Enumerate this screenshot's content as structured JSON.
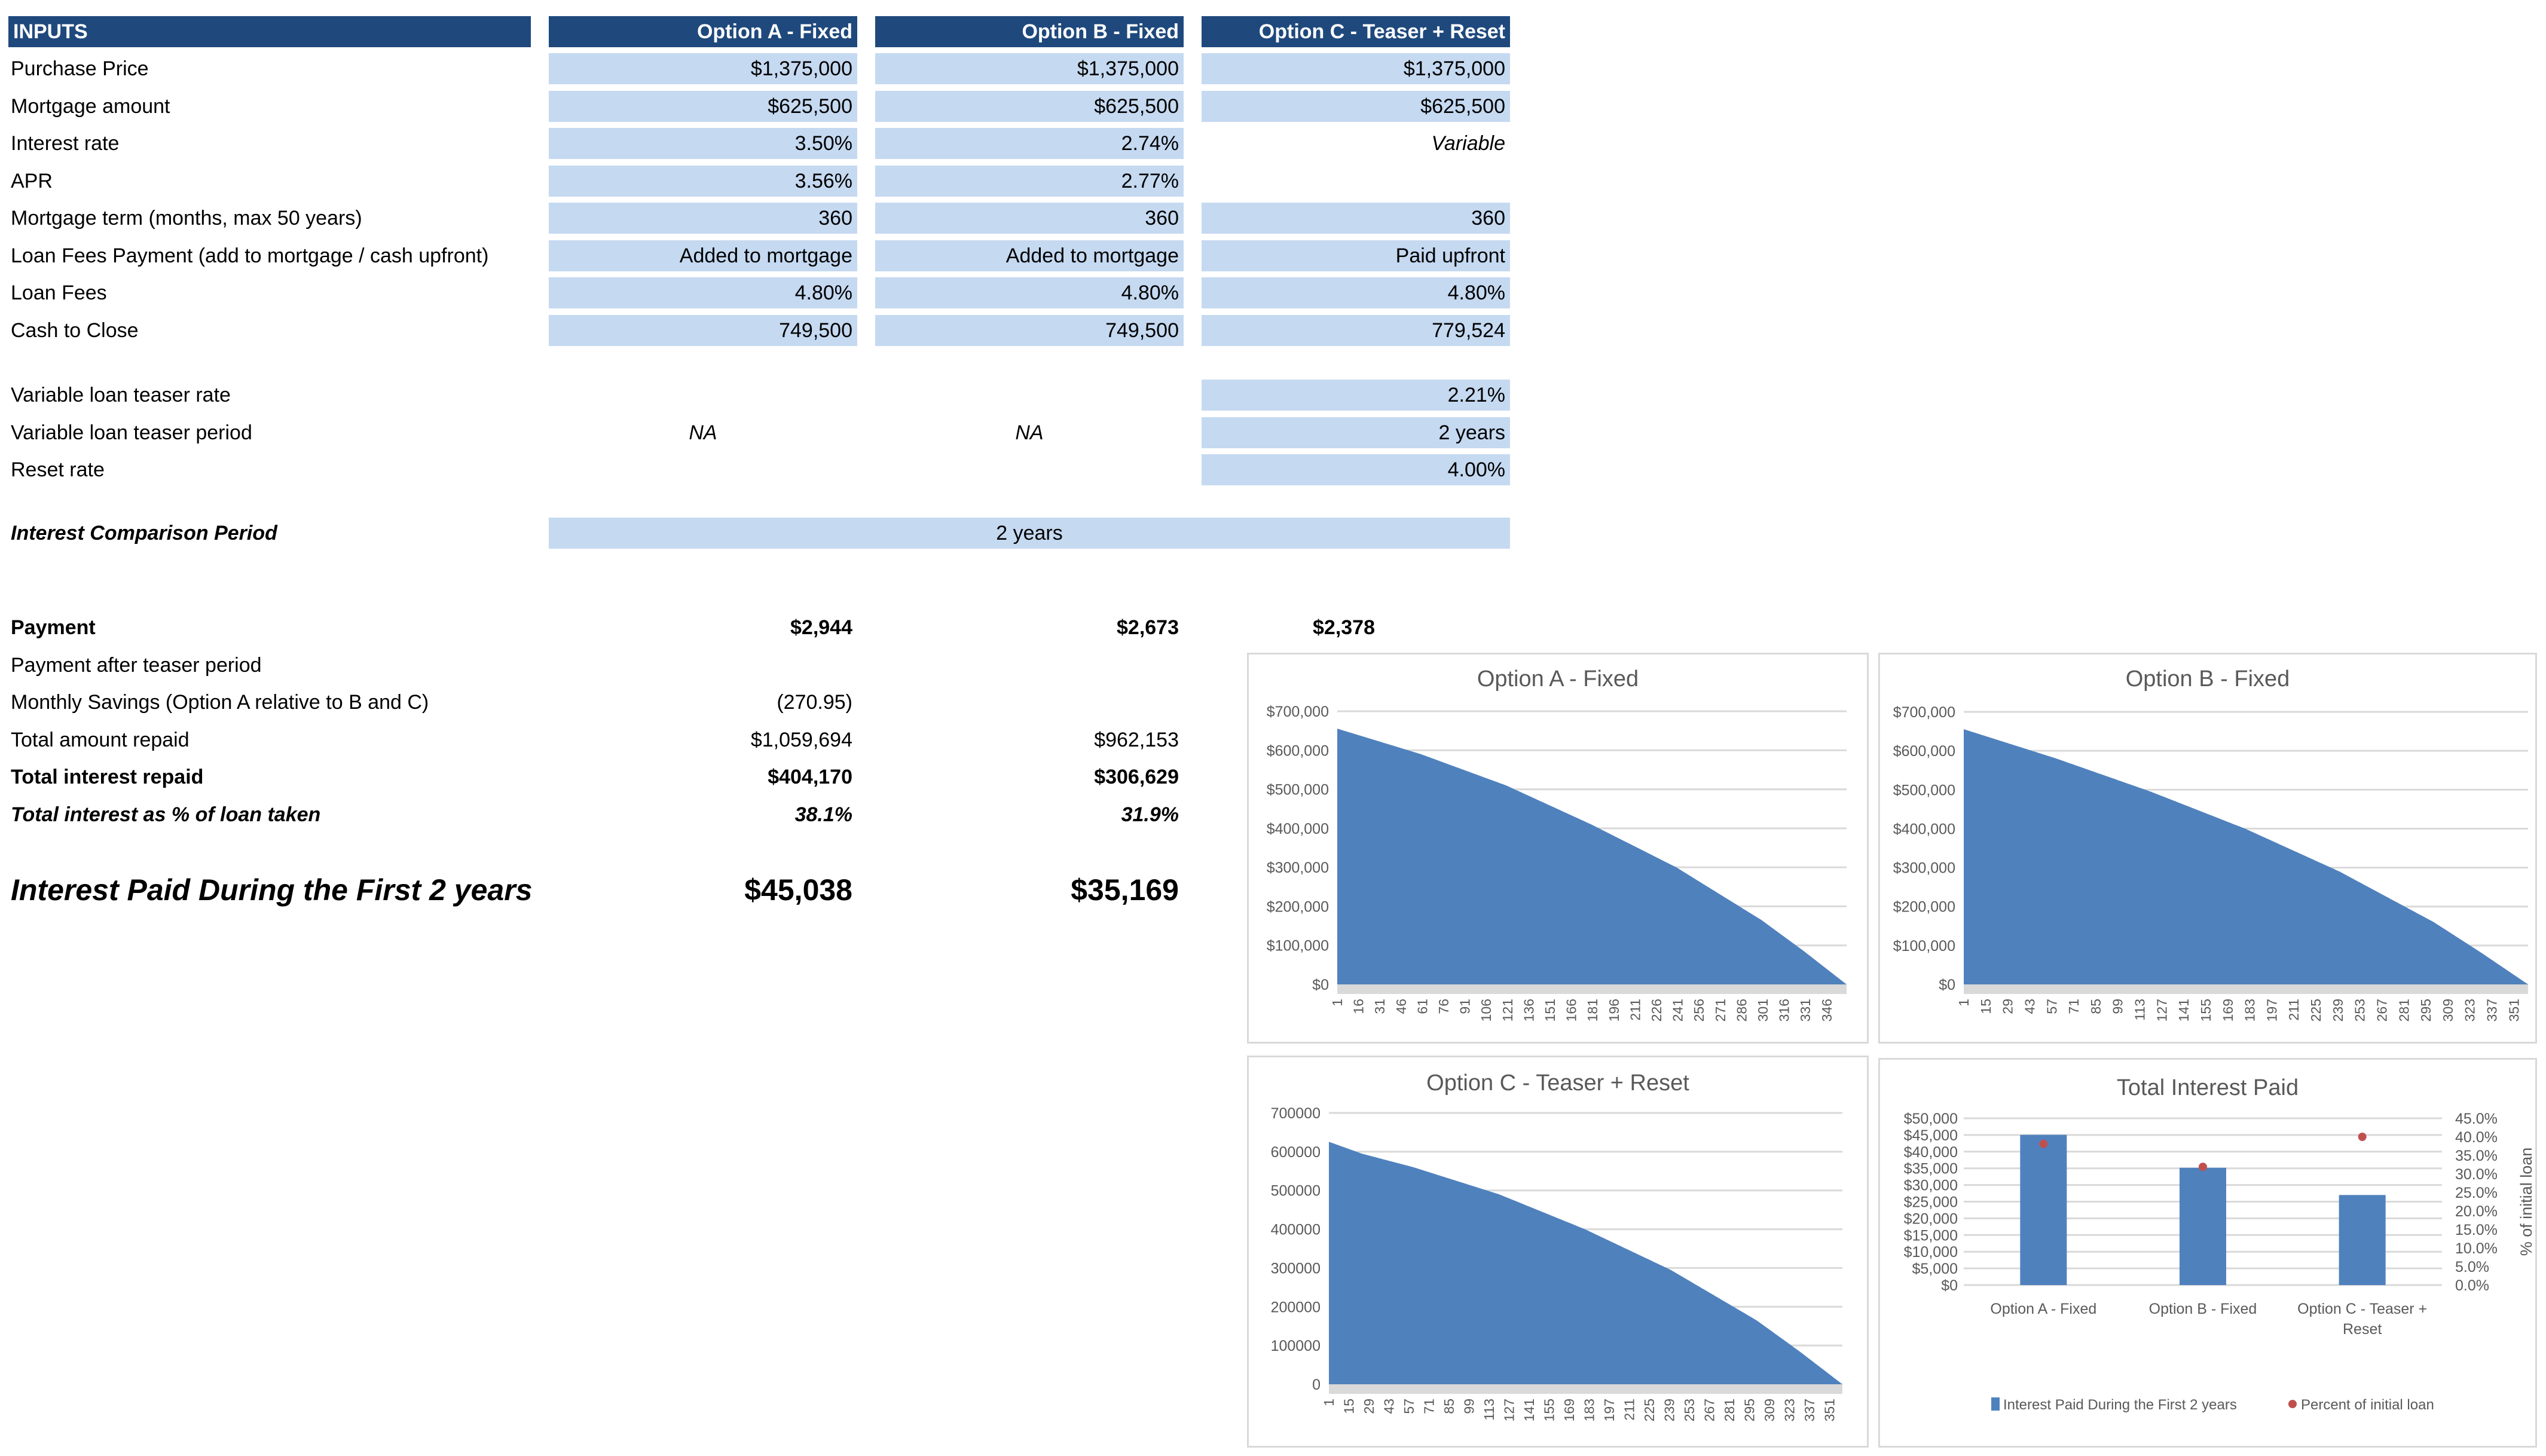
{
  "inputs": {
    "header": "INPUTS",
    "columns": [
      "Option A - Fixed",
      "Option B - Fixed",
      "Option C - Teaser + Reset"
    ],
    "rows": [
      {
        "label": "Purchase Price",
        "values": [
          "$1,375,000",
          "$1,375,000",
          "$1,375,000"
        ]
      },
      {
        "label": "Mortgage amount",
        "values": [
          "$625,500",
          "$625,500",
          "$625,500"
        ]
      },
      {
        "label": "Interest rate",
        "values": [
          "3.50%",
          "2.74%",
          "Variable"
        ]
      },
      {
        "label": "APR",
        "values": [
          "3.56%",
          "2.77%",
          ""
        ]
      },
      {
        "label": "Mortgage term (months, max 50 years)",
        "values": [
          "360",
          "360",
          "360"
        ]
      },
      {
        "label": "Loan Fees Payment (add to mortgage / cash upfront)",
        "values": [
          "Added to mortgage",
          "Added to mortgage",
          "Paid upfront"
        ]
      },
      {
        "label": "Loan Fees",
        "values": [
          "4.80%",
          "4.80%",
          "4.80%"
        ]
      },
      {
        "label": "Cash to Close",
        "values": [
          "749,500",
          "749,500",
          "779,524"
        ]
      }
    ],
    "variable_rows": [
      {
        "label": "Variable loan teaser rate",
        "values": [
          "",
          "",
          "2.21%"
        ]
      },
      {
        "label": "Variable loan teaser period",
        "values": [
          "NA",
          "NA",
          "2 years"
        ]
      },
      {
        "label": "Reset rate",
        "values": [
          "",
          "",
          "4.00%"
        ]
      }
    ],
    "comparison_period": {
      "label": "Interest Comparison Period",
      "value": "2 years"
    }
  },
  "results": {
    "rows": [
      {
        "label": "Payment",
        "values": [
          "$2,944",
          "$2,673",
          "$2,378"
        ]
      },
      {
        "label": "Payment after teaser period",
        "values": [
          "",
          "",
          ""
        ]
      },
      {
        "label": "Monthly Savings (Option A relative to B and C)",
        "values": [
          "(270.95)",
          "",
          ""
        ]
      },
      {
        "label": "Total amount repaid",
        "values": [
          "$1,059,694",
          "$962,153",
          ""
        ]
      },
      {
        "label": "Total interest repaid",
        "values": [
          "$404,170",
          "$306,629",
          ""
        ]
      },
      {
        "label": "Total interest as % of loan taken",
        "values": [
          "38.1%",
          "31.9%",
          ""
        ]
      }
    ],
    "headline": {
      "label": "Interest Paid During the First 2 years",
      "values": [
        "$45,038",
        "$35,169"
      ]
    }
  },
  "colors": {
    "header_bg": "#1f497d",
    "input_fill": "#c5d9f1",
    "series_blue": "#4f81bd",
    "series_red": "#c0504d"
  },
  "chart_data": [
    {
      "type": "area",
      "title": "Option A - Fixed",
      "ylim": [
        0,
        700000
      ],
      "yticks": [
        "$0",
        "$100,000",
        "$200,000",
        "$300,000",
        "$400,000",
        "$500,000",
        "$600,000",
        "$700,000"
      ],
      "xticks": [
        "1",
        "16",
        "31",
        "46",
        "61",
        "76",
        "91",
        "106",
        "121",
        "136",
        "151",
        "166",
        "181",
        "196",
        "211",
        "226",
        "241",
        "256",
        "271",
        "286",
        "301",
        "316",
        "331",
        "346"
      ],
      "x": [
        1,
        60,
        120,
        180,
        240,
        300,
        330,
        360
      ],
      "values": [
        655500,
        590000,
        510000,
        410000,
        300000,
        165000,
        85000,
        0
      ],
      "grid": true
    },
    {
      "type": "area",
      "title": "Option B - Fixed",
      "ylim": [
        0,
        700000
      ],
      "yticks": [
        "$0",
        "$100,000",
        "$200,000",
        "$300,000",
        "$400,000",
        "$500,000",
        "$600,000",
        "$700,000"
      ],
      "xticks": [
        "1",
        "15",
        "29",
        "43",
        "57",
        "71",
        "85",
        "99",
        "113",
        "127",
        "141",
        "155",
        "169",
        "183",
        "197",
        "211",
        "225",
        "239",
        "253",
        "267",
        "281",
        "295",
        "309",
        "323",
        "337",
        "351"
      ],
      "x": [
        1,
        60,
        120,
        180,
        240,
        300,
        330,
        360
      ],
      "values": [
        655500,
        580000,
        495000,
        400000,
        290000,
        160000,
        82000,
        0
      ],
      "grid": true
    },
    {
      "type": "area",
      "title": "Option C - Teaser + Reset",
      "ylim": [
        0,
        700000
      ],
      "yticks": [
        "0",
        "100000",
        "200000",
        "300000",
        "400000",
        "500000",
        "600000",
        "700000"
      ],
      "xticks": [
        "1",
        "15",
        "29",
        "43",
        "57",
        "71",
        "85",
        "99",
        "113",
        "127",
        "141",
        "155",
        "169",
        "183",
        "197",
        "211",
        "225",
        "239",
        "253",
        "267",
        "281",
        "295",
        "309",
        "323",
        "337",
        "351"
      ],
      "x": [
        1,
        24,
        60,
        120,
        180,
        240,
        300,
        330,
        360
      ],
      "values": [
        625500,
        595000,
        560000,
        490000,
        400000,
        295000,
        165000,
        85000,
        0
      ],
      "grid": true
    },
    {
      "type": "bar",
      "title": "Total Interest Paid",
      "categories": [
        "Option A - Fixed",
        "Option B - Fixed",
        "Option C - Teaser + Reset"
      ],
      "series": [
        {
          "name": "Interest Paid During the First 2 years",
          "type": "bar",
          "axis": "left",
          "values": [
            45038,
            35169,
            27000
          ]
        },
        {
          "name": "Percent of initial loan",
          "type": "scatter",
          "axis": "right",
          "values": [
            38.1,
            31.9,
            40.0
          ]
        }
      ],
      "ylim": [
        0,
        50000
      ],
      "yticks": [
        "$0",
        "$5,000",
        "$10,000",
        "$15,000",
        "$20,000",
        "$25,000",
        "$30,000",
        "$35,000",
        "$40,000",
        "$45,000",
        "$50,000"
      ],
      "y2lim": [
        0,
        45
      ],
      "y2ticks": [
        "0.0%",
        "5.0%",
        "10.0%",
        "15.0%",
        "20.0%",
        "25.0%",
        "30.0%",
        "35.0%",
        "40.0%",
        "45.0%"
      ],
      "y2label": "% of initial loan",
      "legend": "bottom",
      "grid": true
    }
  ]
}
